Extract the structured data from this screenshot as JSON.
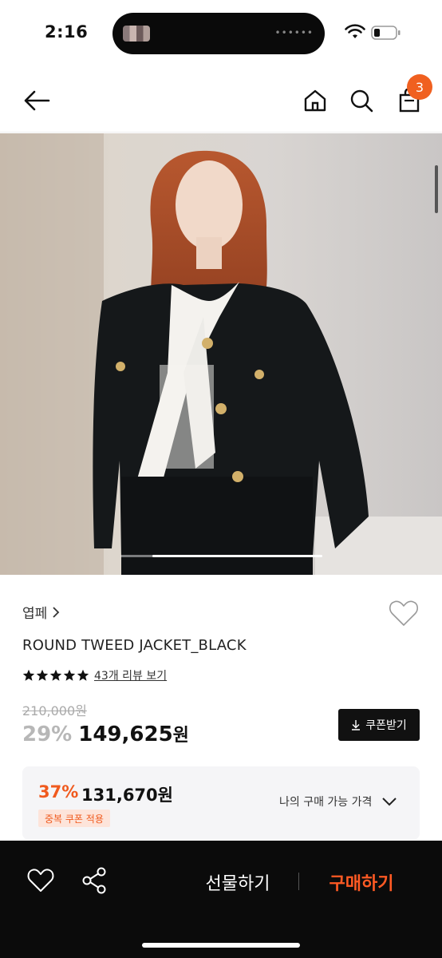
{
  "status_bar": {
    "time": "2:16"
  },
  "nav": {
    "cart_count": "3"
  },
  "product": {
    "brand": "엽페",
    "title": "ROUND TWEED JACKET_BLACK",
    "review_link": "43개 리뷰 보기",
    "rating_stars": 5,
    "original_price": "210,000원",
    "discount_rate": "29%",
    "sale_price": "149,625",
    "sale_unit": "원",
    "coupon_button": "쿠폰받기",
    "image_carousel_position": 0.84
  },
  "best_price": {
    "rate": "37%",
    "price": "131,670원",
    "badge": "중복 쿠폰 적용",
    "toggle_label": "나의 구매 가능 가격"
  },
  "bottom_bar": {
    "gift_label": "선물하기",
    "buy_label": "구매하기"
  },
  "colors": {
    "accent": "#f05a1e",
    "buy": "#ff5a24",
    "badge": "#f06020",
    "dark": "#0b0b0b"
  },
  "icons": [
    "back-arrow-icon",
    "home-icon",
    "search-icon",
    "bag-icon",
    "heart-icon",
    "star-icon",
    "download-icon",
    "chevron-down-icon",
    "share-icon"
  ]
}
